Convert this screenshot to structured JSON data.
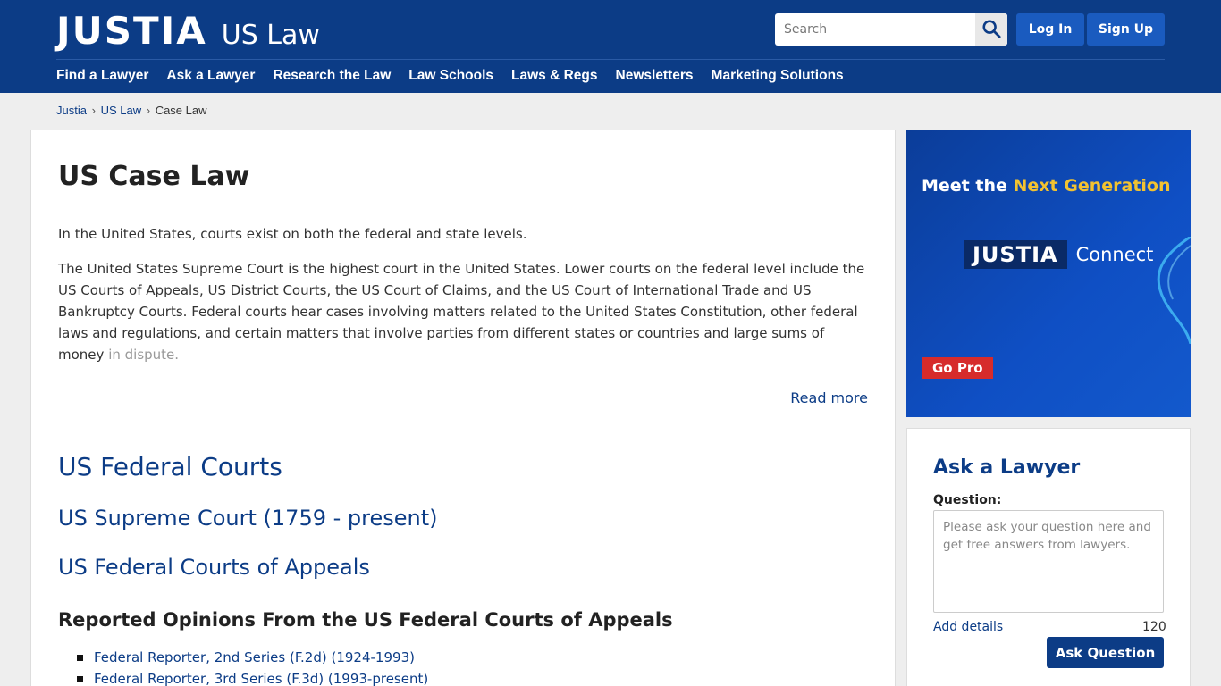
{
  "header": {
    "logo_main": "JUSTIA",
    "logo_sub": "US Law",
    "search_placeholder": "Search",
    "login_label": "Log In",
    "signup_label": "Sign Up",
    "nav": [
      "Find a Lawyer",
      "Ask a Lawyer",
      "Research the Law",
      "Law Schools",
      "Laws & Regs",
      "Newsletters",
      "Marketing Solutions"
    ]
  },
  "breadcrumb": {
    "items": [
      "Justia",
      "US Law",
      "Case Law"
    ],
    "separator": "›"
  },
  "main": {
    "title": "US Case Law",
    "para1": "In the United States, courts exist on both the federal and state levels.",
    "para2": "The United States Supreme Court is the highest court in the United States. Lower courts on the federal level include the US Courts of Appeals, US District Courts, the US Court of Claims, and the US Court of International Trade and US Bankruptcy Courts. Federal courts hear cases involving matters related to the United States Constitution, other federal laws and regulations, and certain matters that involve parties from different states or countries and large sums of money",
    "para2_fade": "in dispute.",
    "read_more": "Read more",
    "federal_courts": "US Federal Courts",
    "supreme_court": "US Supreme Court (1759 - present)",
    "courts_of_appeals": "US Federal Courts of Appeals",
    "reported_opinions": "Reported Opinions From the US Federal Courts of Appeals",
    "reporters": [
      "Federal Reporter, 2nd Series (F.2d) (1924-1993)",
      "Federal Reporter, 3rd Series (F.3d) (1993-present)"
    ]
  },
  "ad": {
    "headline_pre": "Meet the ",
    "headline_accent": "Next Generation",
    "logo_box": "JUSTIA",
    "logo_sub": "Connect",
    "cta": "Go Pro",
    "accent_color": "#f2c230",
    "cta_color": "#d62b2b"
  },
  "ask": {
    "title": "Ask a Lawyer",
    "question_label": "Question:",
    "placeholder": "Please ask your question here and get free answers from lawyers.",
    "add_details": "Add details",
    "char_count": "120",
    "button": "Ask Question"
  },
  "colors": {
    "brand": "#0c3c86",
    "button_blue": "#1a5bbf"
  },
  "icons": {
    "search": "search-icon"
  }
}
